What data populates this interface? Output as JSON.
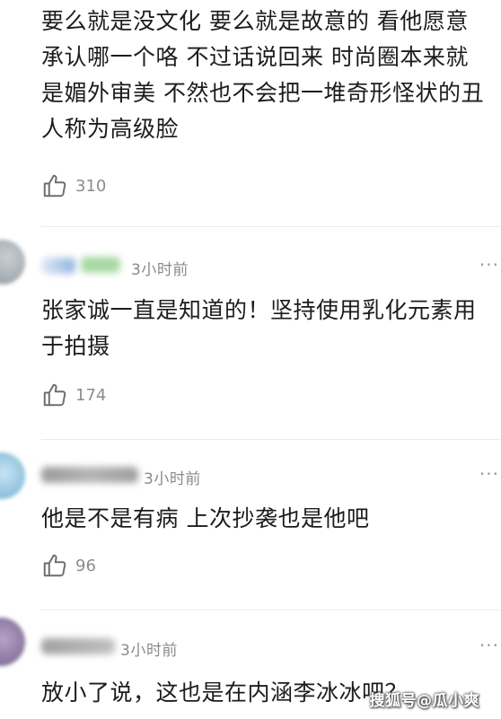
{
  "comments": [
    {
      "text": "要么就是没文化 要么就是故意的 看他愿意承认哪一个咯 不过话说回来 时尚圈本来就是媚外审美 不然也不会把一堆奇形怪状的丑人称为高级脸",
      "likes": "310"
    },
    {
      "time": "3小时前",
      "text": "张家诚一直是知道的！坚持使用乳化元素用于拍摄",
      "likes": "174",
      "more": "···"
    },
    {
      "time": "3小时前",
      "text": "他是不是有病 上次抄袭也是他吧",
      "likes": "96",
      "more": "···"
    },
    {
      "time": "3小时前",
      "text": "放小了说，这也是在内涵李冰冰吧？",
      "more": "···"
    }
  ],
  "watermark": "搜狐号@瓜小爽",
  "colors": {
    "divider": "#ececec",
    "muted_text": "#8a8a8a",
    "body_text": "#1c1c1c"
  },
  "icons": {
    "like": "thumbs-up-icon",
    "more": "more-dots-icon"
  }
}
